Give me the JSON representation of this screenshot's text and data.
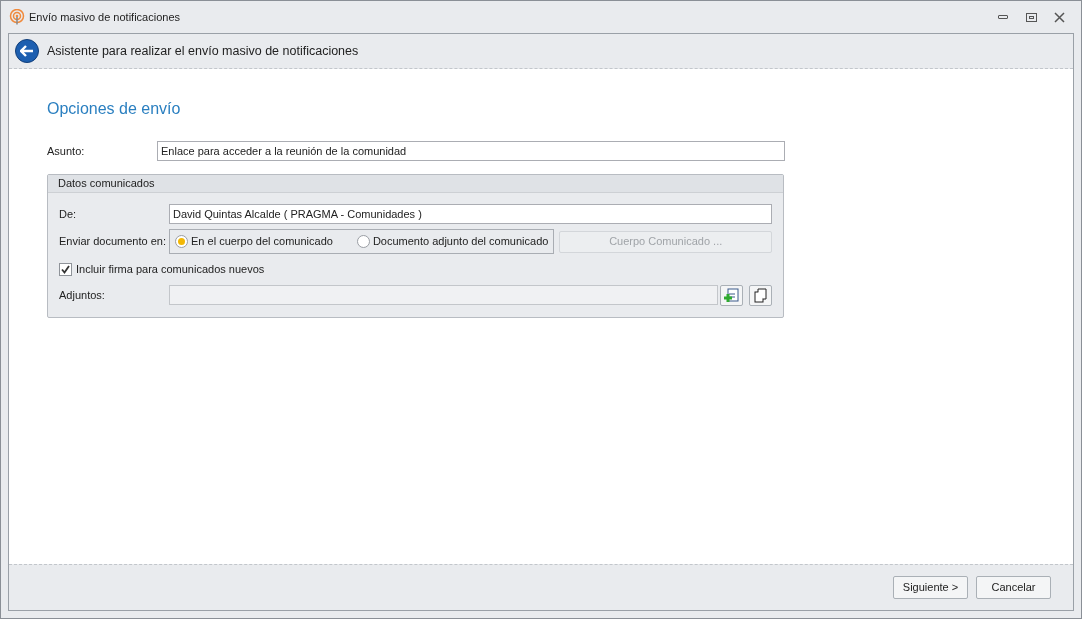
{
  "window": {
    "title": "Envío masivo de notificaciones"
  },
  "header": {
    "title": "Asistente para realizar el envío masivo de notificaciones"
  },
  "section_title": "Opciones de envío",
  "subject": {
    "label": "Asunto:",
    "value": "Enlace para acceder a la reunión de la comunidad"
  },
  "group": {
    "title": "Datos comunicados",
    "from": {
      "label": "De:",
      "value": "David Quintas Alcalde ( PRAGMA - Comunidades )"
    },
    "send_in": {
      "label": "Enviar documento en:",
      "options": [
        {
          "label": "En el cuerpo del comunicado",
          "selected": true
        },
        {
          "label": "Documento adjunto del comunicado",
          "selected": false
        }
      ],
      "button": {
        "label": "Cuerpo Comunicado ...",
        "disabled": true
      }
    },
    "signature": {
      "label": "Incluir firma para comunicados nuevos",
      "checked": true
    },
    "attachments": {
      "label": "Adjuntos:"
    }
  },
  "buttons": [
    {
      "label": "Siguiente >"
    },
    {
      "label": "Cancelar"
    }
  ]
}
